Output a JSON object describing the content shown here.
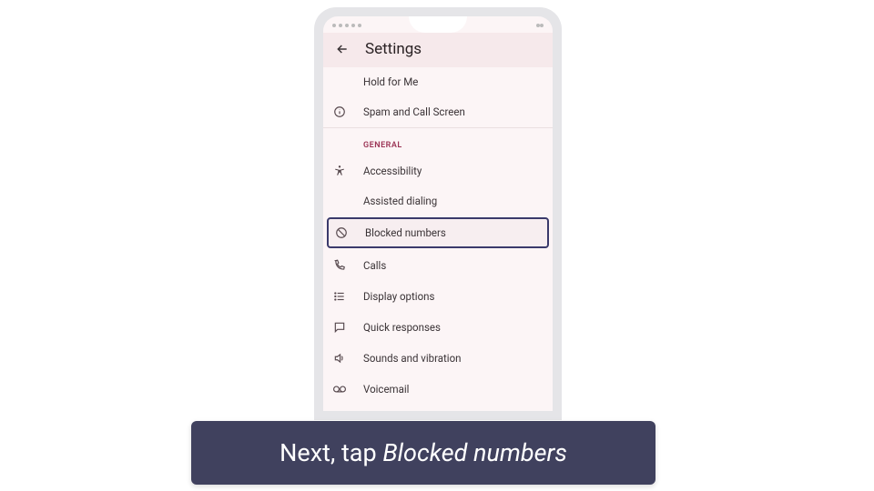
{
  "header": {
    "title": "Settings"
  },
  "items": {
    "hold_for_me": "Hold for Me",
    "spam_call_screen": "Spam and Call Screen",
    "accessibility": "Accessibility",
    "assisted_dialing": "Assisted dialing",
    "blocked_numbers": "Blocked numbers",
    "calls": "Calls",
    "display_options": "Display options",
    "quick_responses": "Quick responses",
    "sounds_vibration": "Sounds and vibration",
    "voicemail": "Voicemail"
  },
  "sections": {
    "general": "GENERAL"
  },
  "caption": {
    "prefix": "Next, tap ",
    "em": "Blocked numbers"
  }
}
